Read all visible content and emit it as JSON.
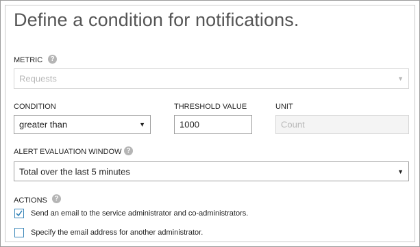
{
  "title": "Define a condition for notifications.",
  "metric": {
    "label": "METRIC",
    "help_icon": "?",
    "value": "Requests"
  },
  "condition": {
    "label": "CONDITION",
    "value": "greater than"
  },
  "threshold": {
    "label": "THRESHOLD VALUE",
    "value": "1000"
  },
  "unit": {
    "label": "UNIT",
    "value": "Count"
  },
  "window": {
    "label": "ALERT EVALUATION WINDOW",
    "help_icon": "?",
    "value": "Total over the last 5 minutes"
  },
  "actions": {
    "label": "ACTIONS",
    "help_icon": "?",
    "items": [
      {
        "label": "Send an email to the service administrator and co-administrators.",
        "checked": true
      },
      {
        "label": "Specify the email address for another administrator.",
        "checked": false
      }
    ]
  },
  "colors": {
    "check_border": "#3a86b8",
    "check_mark": "#3a86b8",
    "title": "#555555"
  },
  "icons": {
    "dropdown": "chevron-down-icon",
    "help": "help-icon",
    "check": "checkmark-icon"
  }
}
